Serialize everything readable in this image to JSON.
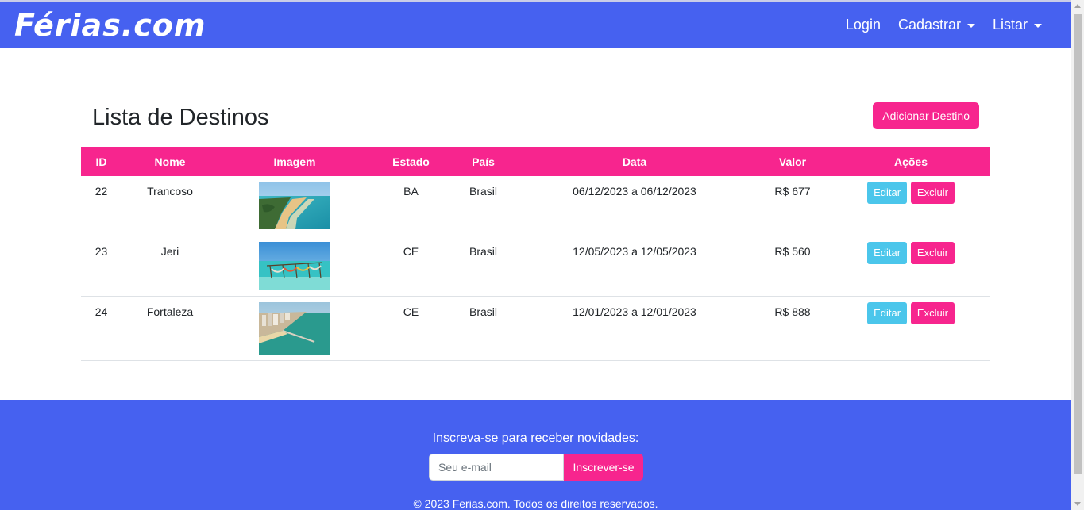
{
  "brand": "Férias.com",
  "nav": {
    "login": "Login",
    "cadastrar": "Cadastrar",
    "listar": "Listar"
  },
  "main": {
    "title": "Lista de Destinos",
    "add_button": "Adicionar Destino"
  },
  "table": {
    "headers": [
      "ID",
      "Nome",
      "Imagem",
      "Estado",
      "País",
      "Data",
      "Valor",
      "Ações"
    ],
    "rows": [
      {
        "id": "22",
        "nome": "Trancoso",
        "estado": "BA",
        "pais": "Brasil",
        "data": "06/12/2023 a 06/12/2023",
        "valor": "R$ 677",
        "edit": "Editar",
        "delete": "Excluir"
      },
      {
        "id": "23",
        "nome": "Jeri",
        "estado": "CE",
        "pais": "Brasil",
        "data": "12/05/2023 a 12/05/2023",
        "valor": "R$ 560",
        "edit": "Editar",
        "delete": "Excluir"
      },
      {
        "id": "24",
        "nome": "Fortaleza",
        "estado": "CE",
        "pais": "Brasil",
        "data": "12/01/2023 a 12/01/2023",
        "valor": "R$ 888",
        "edit": "Editar",
        "delete": "Excluir"
      }
    ]
  },
  "footer": {
    "cta": "Inscreva-se para receber novidades:",
    "email_placeholder": "Seu e-mail",
    "subscribe_button": "Inscrever-se",
    "copyright": "© 2023 Ferias.com. Todos os direitos reservados."
  },
  "colors": {
    "primary_blue": "#4661f0",
    "accent_pink": "#f7258e",
    "info_cyan": "#4bc6eb"
  }
}
